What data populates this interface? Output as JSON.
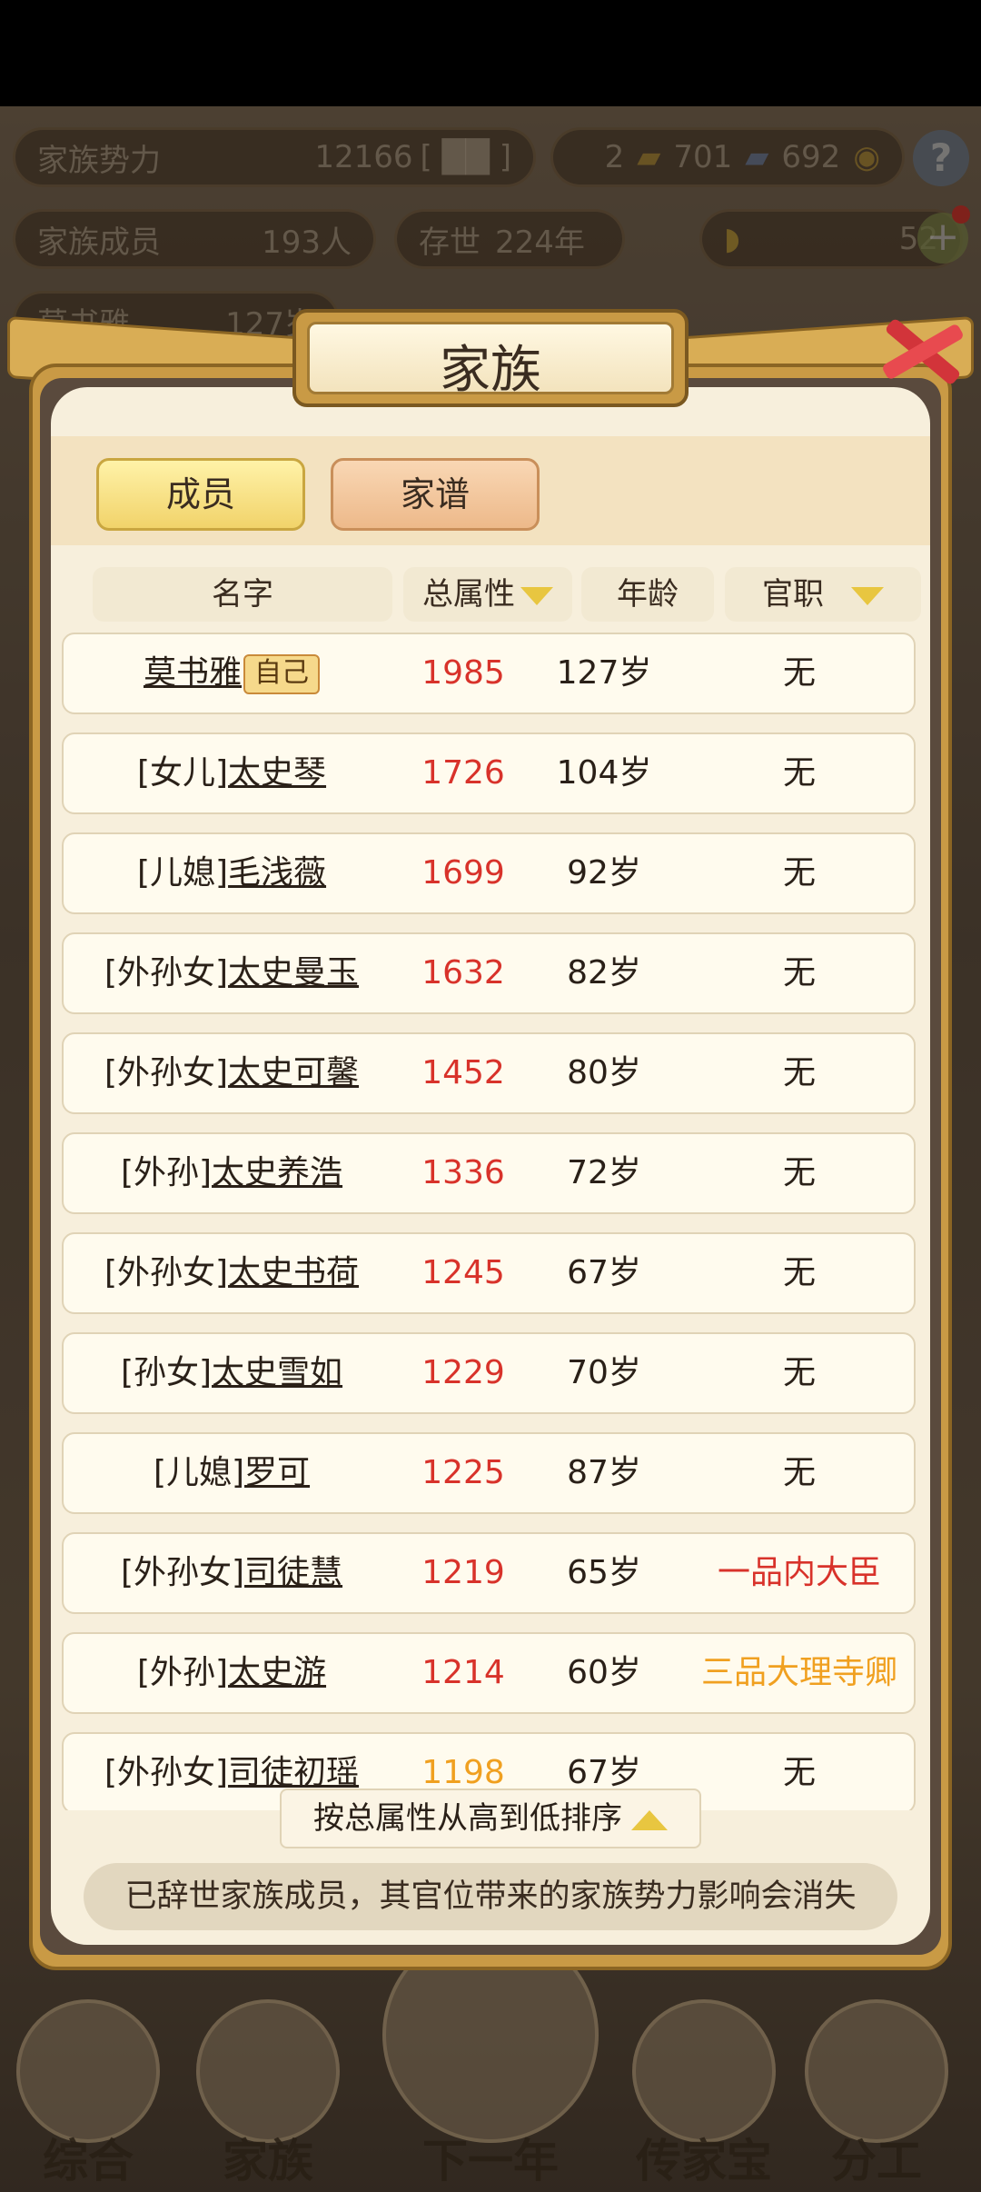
{
  "background": {
    "family_power_label": "家族势力",
    "family_power_value": "12166",
    "resource_counts": {
      "gold_bars": "2",
      "cards_a": "701",
      "cards_b": "692"
    },
    "members_label": "家族成员",
    "members_value": "193人",
    "existence_label": "存世",
    "existence_value": "224年",
    "ingot_value": "52",
    "self_label": "莫书雅",
    "self_age": "127岁",
    "nav": [
      "综合",
      "家族",
      "下一年",
      "传家宝",
      "分工"
    ]
  },
  "dialog": {
    "title": "家族",
    "tabs": {
      "members": "成员",
      "genealogy": "家谱"
    },
    "headers": {
      "name": "名字",
      "attr": "总属性",
      "age": "年龄",
      "post": "官职"
    },
    "self_tag": "自己",
    "rows": [
      {
        "prefix": "",
        "name": "莫书雅",
        "attr": "1985",
        "age": "127岁",
        "post": "无"
      },
      {
        "prefix": "[女儿]",
        "name": "太史琴",
        "attr": "1726",
        "age": "104岁",
        "post": "无"
      },
      {
        "prefix": "[儿媳]",
        "name": "毛浅薇",
        "attr": "1699",
        "age": "92岁",
        "post": "无"
      },
      {
        "prefix": "[外孙女]",
        "name": "太史曼玉",
        "attr": "1632",
        "age": "82岁",
        "post": "无"
      },
      {
        "prefix": "[外孙女]",
        "name": "太史可馨",
        "attr": "1452",
        "age": "80岁",
        "post": "无"
      },
      {
        "prefix": "[外孙]",
        "name": "太史养浩",
        "attr": "1336",
        "age": "72岁",
        "post": "无"
      },
      {
        "prefix": "[外孙女]",
        "name": "太史书荷",
        "attr": "1245",
        "age": "67岁",
        "post": "无"
      },
      {
        "prefix": "[孙女]",
        "name": "太史雪如",
        "attr": "1229",
        "age": "70岁",
        "post": "无"
      },
      {
        "prefix": "[儿媳]",
        "name": "罗可",
        "attr": "1225",
        "age": "87岁",
        "post": "无"
      },
      {
        "prefix": "[外孙女]",
        "name": "司徒慧",
        "attr": "1219",
        "age": "65岁",
        "post": "一品内大臣"
      },
      {
        "prefix": "[外孙]",
        "name": "太史游",
        "attr": "1214",
        "age": "60岁",
        "post": "三品大理寺卿"
      },
      {
        "prefix": "[外孙女]",
        "name": "司徒初瑶",
        "attr": "1198",
        "age": "67岁",
        "post": "无"
      }
    ],
    "sort_label": "按总属性从高到低排序",
    "notice": "已辞世家族成员，其官位带来的家族势力影响会消失"
  },
  "colors": {
    "attr_red": "#d8322a",
    "attr_orange": "#f0a020",
    "post_red": "#d8322a",
    "post_orange": "#f0a020"
  }
}
